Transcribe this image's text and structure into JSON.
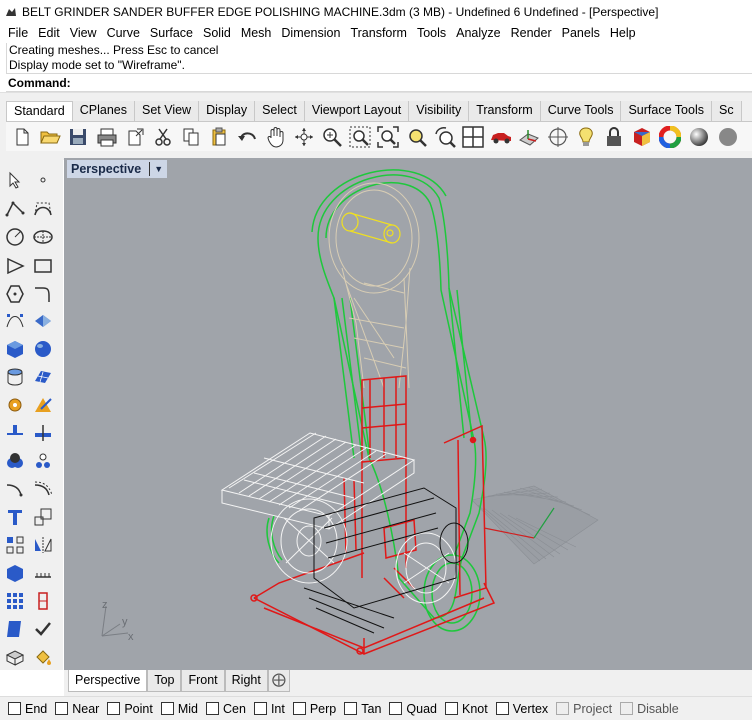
{
  "window": {
    "title": "BELT GRINDER SANDER BUFFER EDGE POLISHING MACHINE.3dm (3 MB) - Undefined 6 Undefined - [Perspective]"
  },
  "menu": [
    "File",
    "Edit",
    "View",
    "Curve",
    "Surface",
    "Solid",
    "Mesh",
    "Dimension",
    "Transform",
    "Tools",
    "Analyze",
    "Render",
    "Panels",
    "Help"
  ],
  "history": {
    "line1": "Creating meshes... Press Esc to cancel",
    "line2": "Display mode set to \"Wireframe\"."
  },
  "command": {
    "label": "Command:",
    "value": ""
  },
  "toolbar_tabs": [
    "Standard",
    "CPlanes",
    "Set View",
    "Display",
    "Select",
    "Viewport Layout",
    "Visibility",
    "Transform",
    "Curve Tools",
    "Surface Tools",
    "Sc"
  ],
  "toolbar_icons": [
    "new-icon",
    "open-icon",
    "save-icon",
    "print-icon",
    "import-icon",
    "cut-icon",
    "copy-icon",
    "paste-icon",
    "undo-icon",
    "pan-icon",
    "rotate-view-icon",
    "zoom-icon",
    "zoom-window-icon",
    "zoom-extents-icon",
    "zoom-selected-icon",
    "rotate-icon",
    "four-viewports-icon",
    "car-icon",
    "cplane-icon",
    "target-icon",
    "light-icon",
    "lock-icon",
    "material-icon",
    "color-wheel-icon",
    "sphere-icon",
    "render-icon"
  ],
  "viewport": {
    "label": "Perspective",
    "axis_x": "x",
    "axis_y": "y",
    "axis_z": "z"
  },
  "viewport_tabs": [
    "Perspective",
    "Top",
    "Front",
    "Right"
  ],
  "osnaps": [
    {
      "label": "End",
      "checked": false,
      "enabled": true
    },
    {
      "label": "Near",
      "checked": false,
      "enabled": true
    },
    {
      "label": "Point",
      "checked": false,
      "enabled": true
    },
    {
      "label": "Mid",
      "checked": false,
      "enabled": true
    },
    {
      "label": "Cen",
      "checked": false,
      "enabled": true
    },
    {
      "label": "Int",
      "checked": false,
      "enabled": true
    },
    {
      "label": "Perp",
      "checked": false,
      "enabled": true
    },
    {
      "label": "Tan",
      "checked": false,
      "enabled": true
    },
    {
      "label": "Quad",
      "checked": false,
      "enabled": true
    },
    {
      "label": "Knot",
      "checked": false,
      "enabled": true
    },
    {
      "label": "Vertex",
      "checked": false,
      "enabled": true
    },
    {
      "label": "Project",
      "checked": false,
      "enabled": false
    },
    {
      "label": "Disable",
      "checked": false,
      "enabled": false
    }
  ],
  "colors": {
    "viewport_bg": "#a0a4aa",
    "belt": "#1ec83c",
    "frame": "#e01818",
    "arm": "#d8cdb4",
    "platen": "#f4f4f4",
    "axle": "#f0e020"
  }
}
